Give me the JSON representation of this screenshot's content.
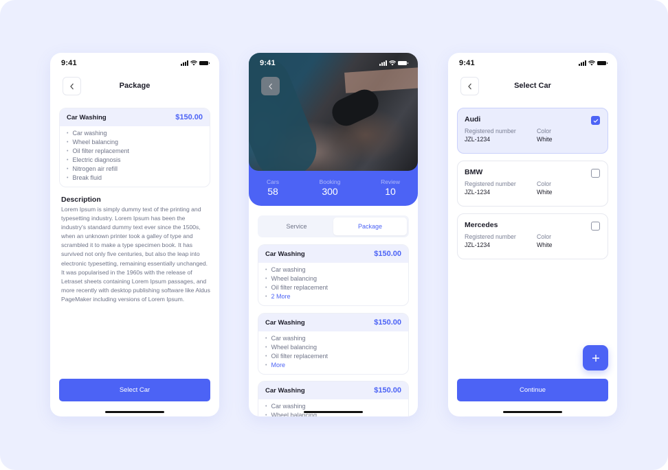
{
  "colors": {
    "accent": "#4C63F5",
    "background": "#ECEFFE",
    "card_header": "#EEF0FD"
  },
  "status_bar": {
    "time": "9:41",
    "icons": [
      "signal-icon",
      "wifi-icon",
      "battery-icon"
    ]
  },
  "package_screen": {
    "title": "Package",
    "back_icon": "chevron-left-icon",
    "package": {
      "name": "Car Washing",
      "price": "$150.00",
      "items": [
        "Car washing",
        "Wheel balancing",
        "Oil filter replacement",
        "Electric diagnosis",
        "Nitrogen air refill",
        "Break fluid"
      ]
    },
    "description_title": "Description",
    "description": "Lorem Ipsum is simply dummy text of the printing and typesetting industry. Lorem Ipsum has been the industry's standard dummy text ever since the 1500s, when an unknown printer took a galley of type and scrambled it to make a type specimen book. It has survived not only five centuries, but also the leap into electronic typesetting, remaining essentially unchanged. It was popularised in the 1960s with the release of Letraset sheets containing Lorem Ipsum passages, and more recently with desktop publishing software like Aldus PageMaker including versions of Lorem Ipsum.",
    "button_label": "Select Car"
  },
  "shop_screen": {
    "stats": [
      {
        "label": "Cars",
        "value": "58"
      },
      {
        "label": "Booking",
        "value": "300"
      },
      {
        "label": "Review",
        "value": "10"
      }
    ],
    "tabs": [
      {
        "label": "Service",
        "active": false
      },
      {
        "label": "Package",
        "active": true
      }
    ],
    "packages": [
      {
        "name": "Car Washing",
        "price": "$150.00",
        "items": [
          "Car washing",
          "Wheel balancing",
          "Oil filter replacement"
        ],
        "more": "2 More"
      },
      {
        "name": "Car Washing",
        "price": "$150.00",
        "items": [
          "Car washing",
          "Wheel balancing",
          "Oil filter replacement"
        ],
        "more": "More"
      },
      {
        "name": "Car Washing",
        "price": "$150.00",
        "items": [
          "Car washing",
          "Wheel balancing"
        ],
        "more": ""
      }
    ]
  },
  "select_car_screen": {
    "title": "Select Car",
    "cars": [
      {
        "name": "Audi",
        "reg_label": "Registered number",
        "reg": "JZL-1234",
        "color_label": "Color",
        "color": "White",
        "checked": true
      },
      {
        "name": "BMW",
        "reg_label": "Registered number",
        "reg": "JZL-1234",
        "color_label": "Color",
        "color": "White",
        "checked": false
      },
      {
        "name": "Mercedes",
        "reg_label": "Registered number",
        "reg": "JZL-1234",
        "color_label": "Color",
        "color": "White",
        "checked": false
      }
    ],
    "fab_icon": "plus-icon",
    "button_label": "Continue"
  }
}
